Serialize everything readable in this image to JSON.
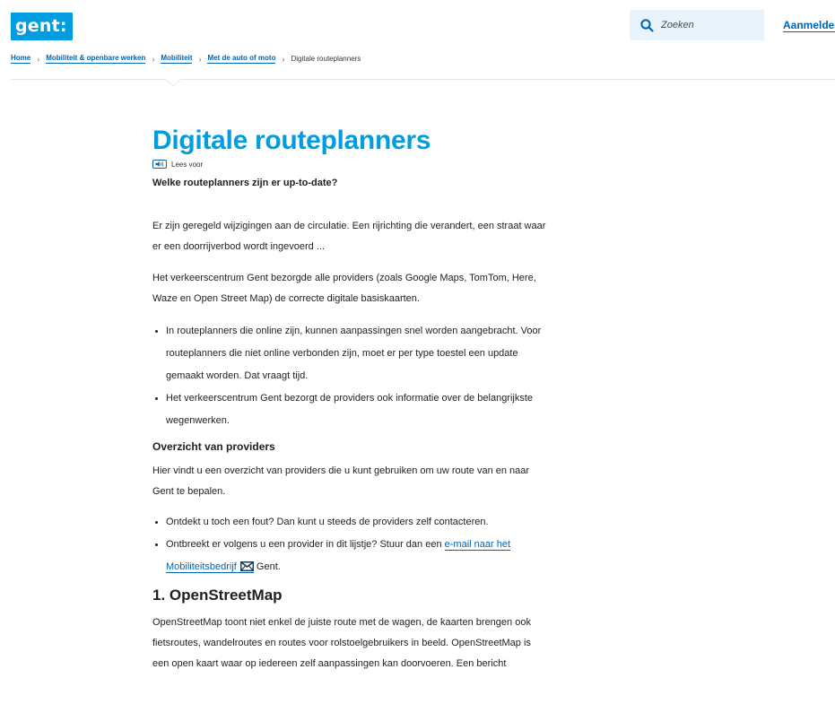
{
  "header": {
    "logo_text": "gent:",
    "search_placeholder": "Zoeken",
    "login_label": "Aanmelden"
  },
  "breadcrumb": {
    "items": [
      "Home",
      "Mobiliteit & openbare werken",
      "Mobiliteit",
      "Met de auto of moto"
    ],
    "current": "Digitale routeplanners"
  },
  "page": {
    "title": "Digitale routeplanners",
    "readspeaker_label": "Lees voor",
    "lead": "Welke routeplanners zijn er up-to-date?",
    "intro_lines": [
      "Er zijn geregeld wijzigingen aan de circulatie. Een rijrichting die verandert, een straat waar",
      "er een doorrijverbod wordt ingevoerd ..."
    ],
    "providers_lines": [
      "Het verkeerscentrum Gent bezorgde alle providers (zoals Google Maps, TomTom, Here,",
      "Waze en Open Street Map) de correcte digitale basiskaarten."
    ],
    "bullets1": [
      [
        "In routeplanners die online zijn, kunnen aanpassingen snel worden aangebracht. Voor",
        "routeplanners die niet online verbonden zijn, moet er per type toestel een update",
        "gemaakt worden. Dat vraagt tijd."
      ],
      [
        "Het verkeerscentrum Gent bezorgt de providers ook informatie over de belangrijkste",
        "wegenwerken."
      ]
    ],
    "overview_heading": "Overzicht van providers",
    "overview_lines": [
      "Hier vindt u een overzicht van providers die u kunt gebruiken om uw route van en naar",
      "Gent te bepalen."
    ],
    "bullet_contact": "Ontdekt u toch een fout? Dan kunt u steeds de providers zelf contacteren.",
    "bullet_missing_prefix": "Ontbreekt er volgens u een provider in dit lijstje? Stuur dan een ",
    "bullet_missing_link_1": "e-mail naar het",
    "bullet_missing_link_2": "Mobiliteitsbedrijf",
    "bullet_missing_suffix": " Gent.",
    "osm_heading": "1. OpenStreetMap",
    "osm_lines": [
      "OpenStreetMap toont niet enkel de juiste route met de wagen, de kaarten brengen ook",
      "fietsroutes, wandelroutes en routes voor rolstoelgebruikers in beeld. OpenStreetMap is",
      "een open kaart waar op iedereen zelf aanpassingen kan doorvoeren. Een bericht"
    ]
  },
  "colors": {
    "brand_blue": "#009de0",
    "link_blue": "#0064b4",
    "search_bg": "#e8f3fb"
  },
  "icons": [
    "search-icon",
    "readspeaker-icon",
    "mail-icon",
    "chevron-right-icon"
  ]
}
